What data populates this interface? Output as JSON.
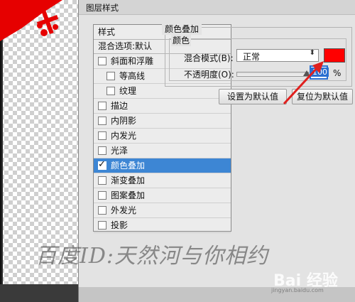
{
  "dialog": {
    "title": "图层样式"
  },
  "styles_panel": {
    "header": "样式",
    "blend_options": "混合选项:默认",
    "items": [
      {
        "label": "斜面和浮雕",
        "checked": false,
        "indent": 0
      },
      {
        "label": "等高线",
        "checked": false,
        "indent": 1
      },
      {
        "label": "纹理",
        "checked": false,
        "indent": 1
      },
      {
        "label": "描边",
        "checked": false,
        "indent": 0
      },
      {
        "label": "内阴影",
        "checked": false,
        "indent": 0
      },
      {
        "label": "内发光",
        "checked": false,
        "indent": 0
      },
      {
        "label": "光泽",
        "checked": false,
        "indent": 0
      },
      {
        "label": "颜色叠加",
        "checked": true,
        "indent": 0,
        "selected": true
      },
      {
        "label": "渐变叠加",
        "checked": false,
        "indent": 0
      },
      {
        "label": "图案叠加",
        "checked": false,
        "indent": 0
      },
      {
        "label": "外发光",
        "checked": false,
        "indent": 0
      },
      {
        "label": "投影",
        "checked": false,
        "indent": 0
      }
    ]
  },
  "color_overlay": {
    "title": "颜色叠加",
    "subgroup_title": "颜色",
    "blend_mode_label": "混合模式(B):",
    "blend_mode_value": "正常",
    "swatch_color": "#ff0000",
    "opacity_label": "不透明度(O):",
    "opacity_value": "100",
    "opacity_unit": "%",
    "make_default_button": "设置为默认值",
    "reset_default_button": "复位为默认值"
  },
  "overlay": {
    "watermark": "百度ID:天然河与你相约",
    "brand_logo": "Bai 经验",
    "brand_url": "jingyan.baidu.com"
  },
  "colors": {
    "selection": "#3d86d4",
    "annotation_arrow": "#e0201e"
  }
}
